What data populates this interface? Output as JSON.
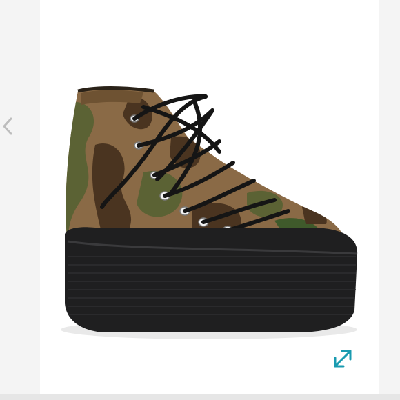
{
  "viewer": {
    "image_subject": "camouflage-high-top-platform-sneaker",
    "prev_icon": "chevron-left-icon",
    "expand_icon": "expand-arrows-icon"
  },
  "colors": {
    "accent": "#1a9bb0",
    "arrow": "#bdbdbd",
    "background": "#ffffff",
    "sole": "#1f1f20",
    "camo_tan": "#8a6a46",
    "camo_olive": "#5b6234",
    "camo_brown": "#4a3420"
  }
}
